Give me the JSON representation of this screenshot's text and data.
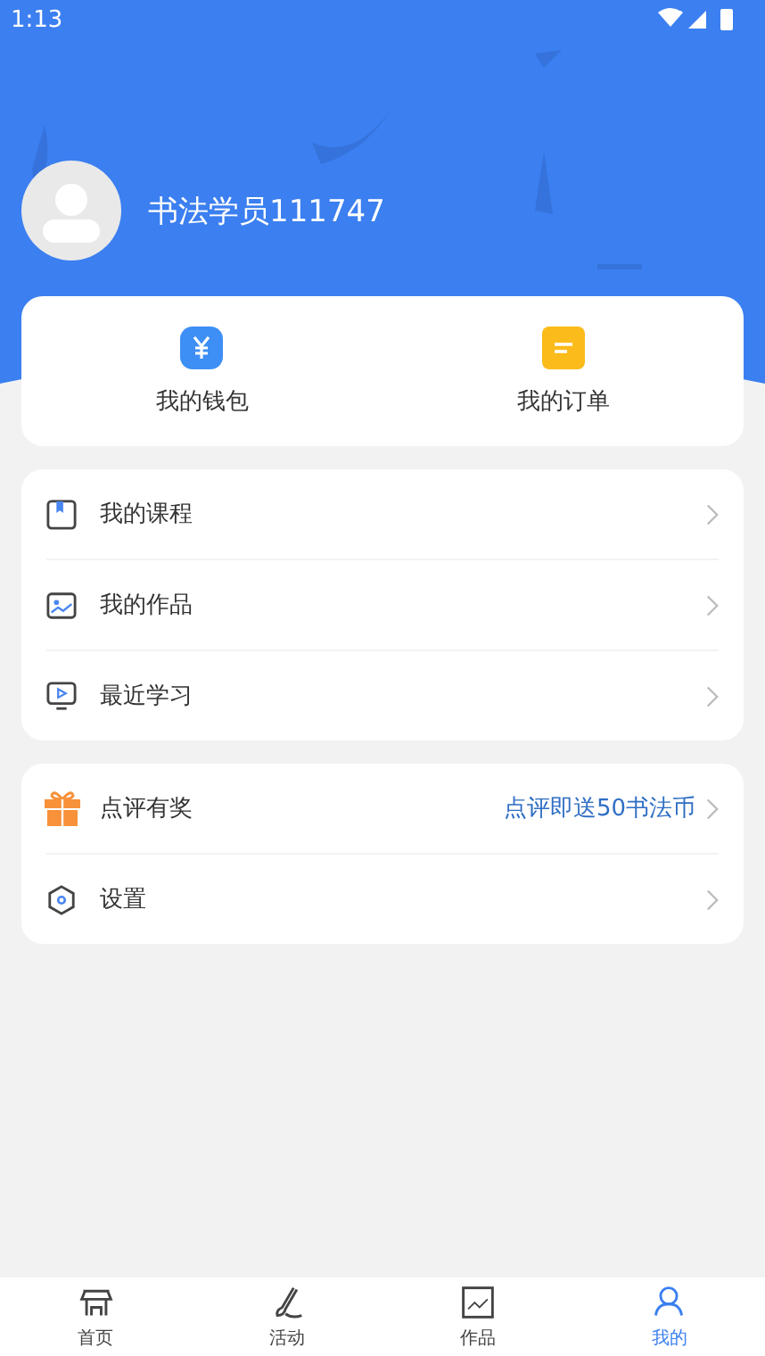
{
  "status_bar": {
    "time": "1:13"
  },
  "profile": {
    "name": "书法学员111747"
  },
  "quick_actions": [
    {
      "label": "我的钱包"
    },
    {
      "label": "我的订单"
    }
  ],
  "menu": [
    {
      "label": "我的课程"
    },
    {
      "label": "我的作品"
    },
    {
      "label": "最近学习"
    }
  ],
  "menu_2": [
    {
      "label": "点评有奖",
      "note": "点评即送50书法币"
    },
    {
      "label": "设置"
    }
  ],
  "tab_bar": [
    {
      "label": "首页",
      "selected": false
    },
    {
      "label": "活动",
      "selected": false
    },
    {
      "label": "作品",
      "selected": false
    },
    {
      "label": "我的",
      "selected": true
    }
  ]
}
